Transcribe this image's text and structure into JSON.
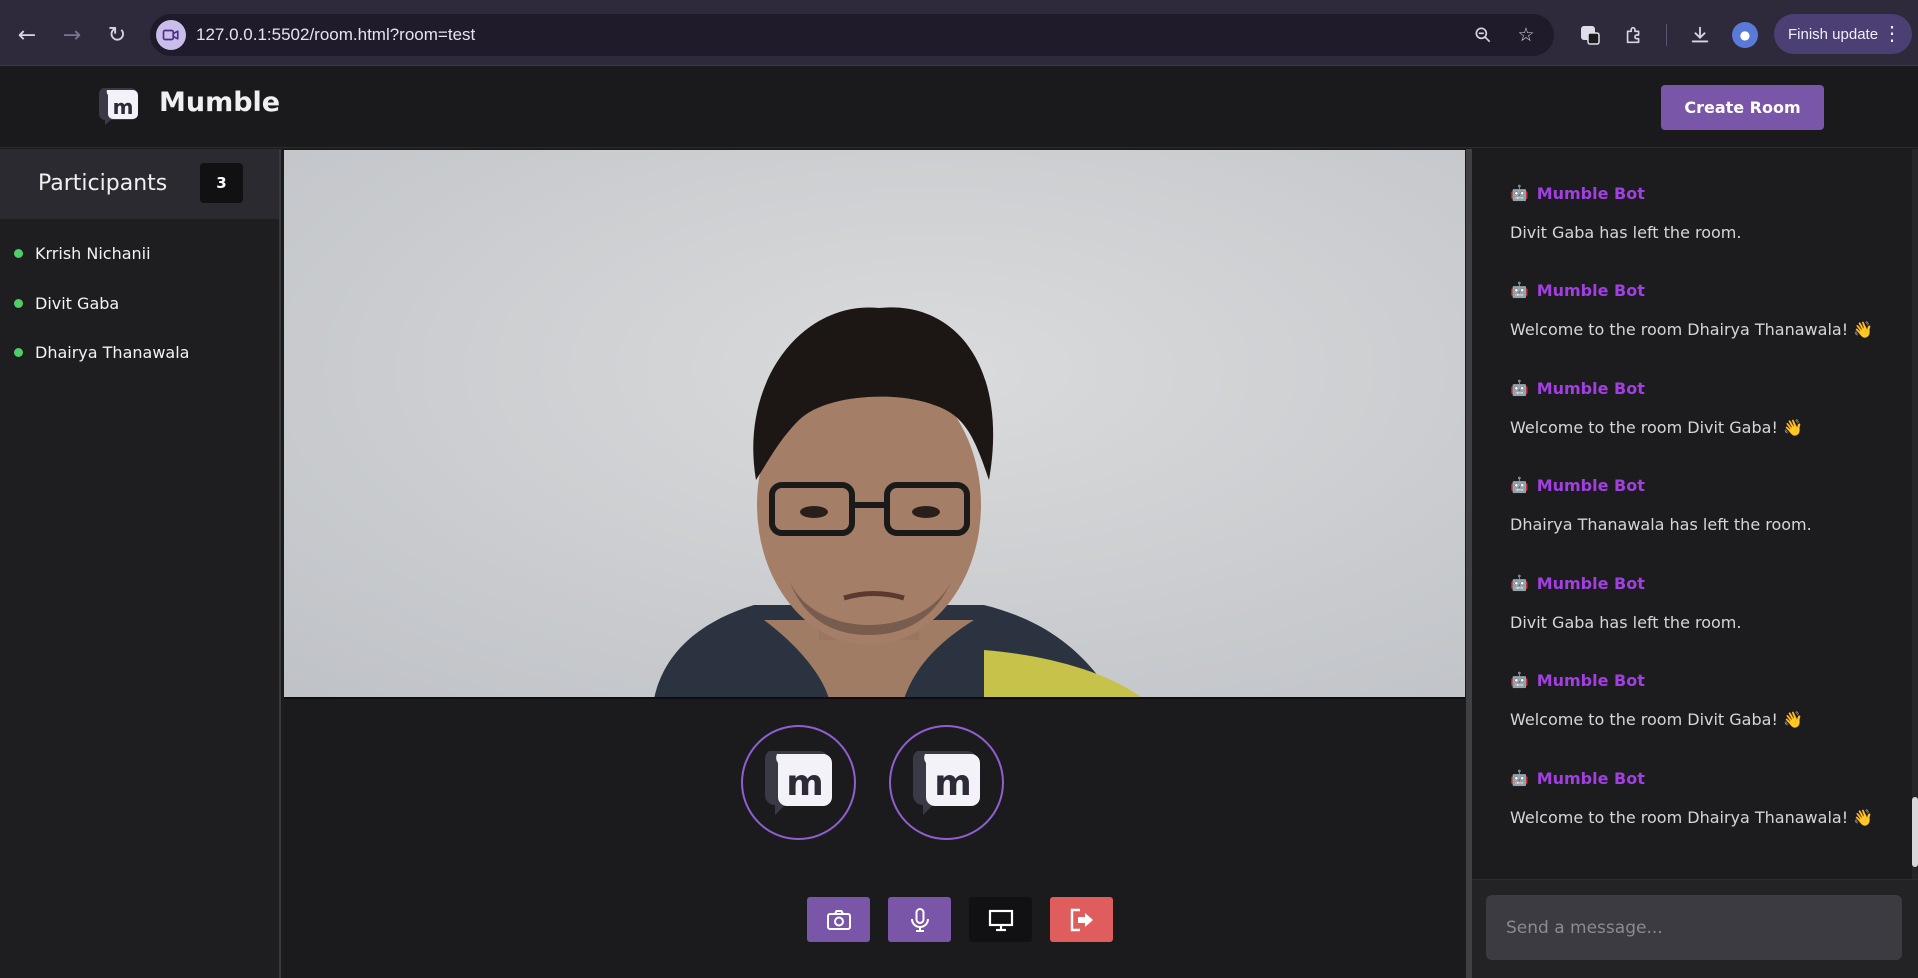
{
  "browser": {
    "url": "127.0.0.1:5502/room.html?room=test",
    "finish_update_label": "Finish update"
  },
  "header": {
    "brand": "Mumble",
    "create_room_label": "Create Room"
  },
  "participants": {
    "title": "Participants",
    "count": "3",
    "items": [
      {
        "name": "Krrish Nichanii"
      },
      {
        "name": "Divit Gaba"
      },
      {
        "name": "Dhairya Thanawala"
      }
    ]
  },
  "chat": {
    "input_placeholder": "Send a message...",
    "messages": [
      {
        "author": "Mumble Bot",
        "text": "Divit Gaba has left the room."
      },
      {
        "author": "Mumble Bot",
        "text": "Welcome to the room Dhairya Thanawala! 👋"
      },
      {
        "author": "Mumble Bot",
        "text": "Welcome to the room Divit Gaba! 👋"
      },
      {
        "author": "Mumble Bot",
        "text": "Dhairya Thanawala has left the room."
      },
      {
        "author": "Mumble Bot",
        "text": "Divit Gaba has left the room."
      },
      {
        "author": "Mumble Bot",
        "text": "Welcome to the room Divit Gaba! 👋"
      },
      {
        "author": "Mumble Bot",
        "text": "Welcome to the room Dhairya Thanawala! 👋"
      }
    ]
  },
  "colors": {
    "accent": "#7a56a8",
    "bot_name": "#a13fe0",
    "online_dot": "#4fce6a",
    "leave_button": "#e05d5d"
  },
  "icons": {
    "controls": [
      "camera-icon",
      "microphone-icon",
      "screen-share-icon",
      "leave-icon"
    ]
  }
}
